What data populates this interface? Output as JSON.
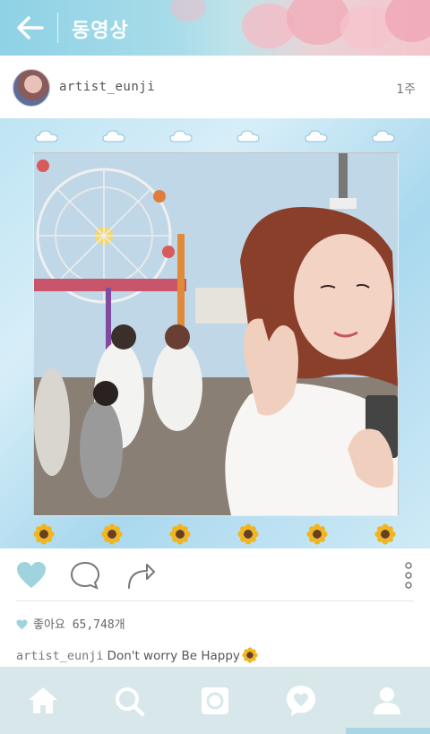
{
  "header": {
    "back_icon": "arrow-left-icon",
    "title": "동영상"
  },
  "post": {
    "username": "artist_eunji",
    "time_ago": "1주",
    "avatar_icon": "avatar"
  },
  "media": {
    "top_decoration": "cloud-icon",
    "bottom_decoration": "sunflower-icon",
    "cloud_count": 6,
    "sunflower_count": 6
  },
  "actions": {
    "like_icon": "heart-icon",
    "comment_icon": "comment-icon",
    "share_icon": "share-icon",
    "more_icon": "more-vertical-icon"
  },
  "likes": {
    "label": "좋아요 65,748개"
  },
  "caption": {
    "username": "artist_eunji",
    "text": "Don't worry Be Happy"
  },
  "bottom_nav": {
    "items": [
      "home-icon",
      "search-icon",
      "camera-icon",
      "activity-icon",
      "profile-icon"
    ]
  },
  "colors": {
    "accent": "#9fd3dd",
    "nav_background": "#d7e7ea",
    "nav_icon": "#ffffff"
  }
}
